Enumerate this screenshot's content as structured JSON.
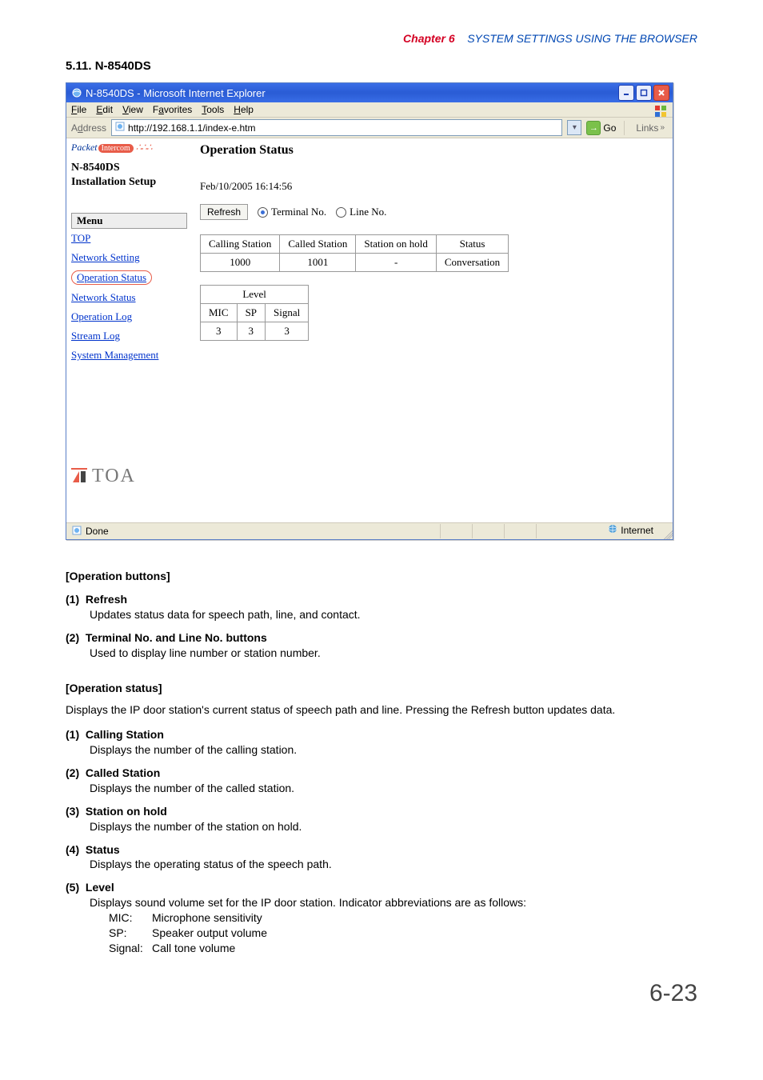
{
  "chapter": {
    "label": "Chapter 6",
    "title": "SYSTEM SETTINGS USING THE BROWSER"
  },
  "section_title": "5.11. N-8540DS",
  "ie": {
    "title": "N-8540DS - Microsoft Internet Explorer",
    "menus": {
      "file": "File",
      "edit": "Edit",
      "view": "View",
      "favorites": "Favorites",
      "tools": "Tools",
      "help": "Help"
    },
    "address_label": "Address",
    "url": "http://192.168.1.1/index-e.htm",
    "go": "Go",
    "links": "Links",
    "status_done": "Done",
    "status_zone": "Internet"
  },
  "sidebar": {
    "packet": "Packet",
    "intercom": "Intercom",
    "model": "N-8540DS",
    "setup": "Installation Setup",
    "menu_label": "Menu",
    "items": [
      {
        "label": "TOP"
      },
      {
        "label": "Network Setting"
      },
      {
        "label": "Operation Status",
        "active": true
      },
      {
        "label": "Network Status"
      },
      {
        "label": "Operation Log"
      },
      {
        "label": "Stream Log"
      },
      {
        "label": "System Management"
      }
    ],
    "brand": "TOA"
  },
  "main": {
    "heading": "Operation Status",
    "timestamp": "Feb/10/2005 16:14:56",
    "refresh": "Refresh",
    "radio_terminal": "Terminal No.",
    "radio_line": "Line No.",
    "status_table": {
      "headers": [
        "Calling Station",
        "Called Station",
        "Station on hold",
        "Status"
      ],
      "row": [
        "1000",
        "1001",
        "-",
        "Conversation"
      ]
    },
    "level_table": {
      "title": "Level",
      "headers": [
        "MIC",
        "SP",
        "Signal"
      ],
      "row": [
        "3",
        "3",
        "3"
      ]
    }
  },
  "doc": {
    "ops_buttons_hdr": "[Operation buttons]",
    "b1": {
      "num": "(1)",
      "name": "Refresh",
      "desc": "Updates status data for speech path, line, and contact."
    },
    "b2": {
      "num": "(2)",
      "name": "Terminal No. and Line No. buttons",
      "desc": "Used to display line number or station number."
    },
    "ops_status_hdr": "[Operation status]",
    "ops_status_intro": "Displays the IP door station's current status of speech path and line. Pressing the Refresh button updates data.",
    "s1": {
      "num": "(1)",
      "name": "Calling Station",
      "desc": "Displays the number of the calling station."
    },
    "s2": {
      "num": "(2)",
      "name": "Called Station",
      "desc": "Displays the number of the called station."
    },
    "s3": {
      "num": "(3)",
      "name": "Station on hold",
      "desc": "Displays the number of the station on hold."
    },
    "s4": {
      "num": "(4)",
      "name": "Status",
      "desc": "Displays the operating status of the speech path."
    },
    "s5": {
      "num": "(5)",
      "name": "Level",
      "desc": "Displays sound volume set for the IP door station. Indicator abbreviations are as follows:"
    },
    "defs": {
      "mic_k": "MIC:",
      "mic_v": "Microphone sensitivity",
      "sp_k": "SP:",
      "sp_v": "Speaker output volume",
      "sig_k": "Signal:",
      "sig_v": "Call tone volume"
    }
  },
  "page_number": "6-23"
}
